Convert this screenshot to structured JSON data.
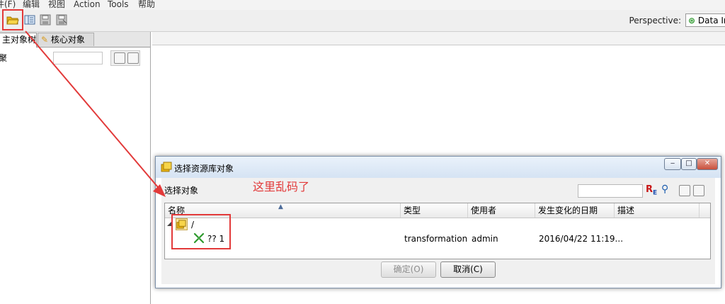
{
  "menubar": {
    "items": [
      "件(F)",
      "编辑",
      "视图",
      "Action",
      "Tools",
      "帮助"
    ]
  },
  "toolbar": {
    "buttons": [
      "open-folder-icon",
      "explore-icon",
      "save-icon",
      "save-as-icon"
    ],
    "perspective_label": "Perspective:",
    "perspective_value": "Data In"
  },
  "left_panel": {
    "tabs": [
      "主对象树",
      "核心对象"
    ],
    "row_label": "聚"
  },
  "dialog": {
    "title": "选择资源库对象",
    "select_label": "选择对象",
    "columns": [
      "名称",
      "类型",
      "使用者",
      "发生变化的日期",
      "描述"
    ],
    "tree_root": "/",
    "row": {
      "name": "?? 1",
      "type": "transformation",
      "user": "admin",
      "date": "2016/04/22 11:19...",
      "description": ""
    },
    "ok_label": "确定(O)",
    "cancel_label": "取消(C)",
    "search_icons": [
      "regex-icon",
      "search-icon",
      "expand-all-icon",
      "collapse-all-icon"
    ]
  },
  "annotation": {
    "text": "这里乱码了",
    "color": "#e23a3a"
  },
  "colors": {
    "accent_folder": "#e7b413",
    "transformation_icon": "#2e9a2e",
    "annotation_red": "#e23a3a"
  }
}
